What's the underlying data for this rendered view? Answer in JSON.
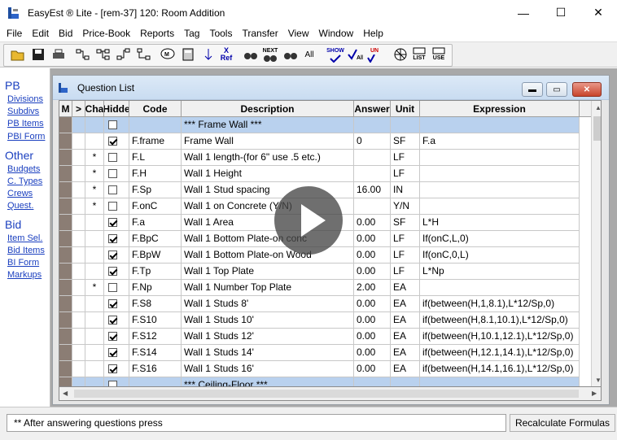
{
  "window": {
    "title": "EasyEst ® Lite - [rem-37] 120: Room Addition",
    "minimize": "—",
    "maximize": "☐",
    "close": "✕"
  },
  "menu": [
    "File",
    "Edit",
    "Bid",
    "Price-Book",
    "Reports",
    "Tag",
    "Tools",
    "Transfer",
    "View",
    "Window",
    "Help"
  ],
  "toolbar": {
    "x_ref": "X\nRef",
    "next": "NEXT",
    "all": "All",
    "show": "SHOW",
    "un": "UN",
    "list": "LIST",
    "use": "USE"
  },
  "side": {
    "pb_head": "PB",
    "pb_links": [
      "Divisions",
      "Subdivs",
      "PB Items",
      "PBI Form"
    ],
    "other_head": "Other",
    "other_links": [
      "Budgets",
      "C. Types",
      "Crews",
      "Quest."
    ],
    "bid_head": "Bid",
    "bid_links": [
      "Item Sel.",
      "Bid Items",
      "BI Form",
      "Markups"
    ]
  },
  "child": {
    "title": "Question List"
  },
  "grid": {
    "headers": [
      "M",
      ">",
      "Cha",
      "Hidde",
      "Code",
      "Description",
      "Answer",
      "Unit",
      "Expression"
    ],
    "rows": [
      {
        "section": true,
        "cha": "",
        "hidden": false,
        "code": "",
        "desc": "*** Frame Wall ***",
        "answer": "",
        "unit": "",
        "expr": ""
      },
      {
        "section": false,
        "cha": "",
        "hidden": true,
        "code": "F.frame",
        "desc": "Frame Wall",
        "answer": "0",
        "unit": "SF",
        "expr": "F.a"
      },
      {
        "section": false,
        "cha": "*",
        "hidden": false,
        "code": "F.L",
        "desc": "Wall 1 length-(for 6\" use .5 etc.)",
        "answer": "",
        "unit": "LF",
        "expr": ""
      },
      {
        "section": false,
        "cha": "*",
        "hidden": false,
        "code": "F.H",
        "desc": "Wall 1 Height",
        "answer": "",
        "unit": "LF",
        "expr": ""
      },
      {
        "section": false,
        "cha": "*",
        "hidden": false,
        "code": "F.Sp",
        "desc": "Wall 1 Stud spacing",
        "answer": "16.00",
        "unit": "IN",
        "expr": ""
      },
      {
        "section": false,
        "cha": "*",
        "hidden": false,
        "code": "F.onC",
        "desc": "Wall 1 on Concrete (Y/N)",
        "answer": "",
        "unit": "Y/N",
        "expr": ""
      },
      {
        "section": false,
        "cha": "",
        "hidden": true,
        "code": "F.a",
        "desc": "Wall 1 Area",
        "answer": "0.00",
        "unit": "SF",
        "expr": "L*H"
      },
      {
        "section": false,
        "cha": "",
        "hidden": true,
        "code": "F.BpC",
        "desc": "Wall 1 Bottom Plate-on conc",
        "answer": "0.00",
        "unit": "LF",
        "expr": "If(onC,L,0)"
      },
      {
        "section": false,
        "cha": "",
        "hidden": true,
        "code": "F.BpW",
        "desc": "Wall 1 Bottom Plate-on Wood",
        "answer": "0.00",
        "unit": "LF",
        "expr": "If(onC,0,L)"
      },
      {
        "section": false,
        "cha": "",
        "hidden": true,
        "code": "F.Tp",
        "desc": "Wall 1 Top Plate",
        "answer": "0.00",
        "unit": "LF",
        "expr": "L*Np"
      },
      {
        "section": false,
        "cha": "*",
        "hidden": false,
        "code": "F.Np",
        "desc": "Wall 1 Number Top Plate",
        "answer": "2.00",
        "unit": "EA",
        "expr": ""
      },
      {
        "section": false,
        "cha": "",
        "hidden": true,
        "code": "F.S8",
        "desc": "Wall 1 Studs 8'",
        "answer": "0.00",
        "unit": "EA",
        "expr": "if(between(H,1,8.1),L*12/Sp,0)"
      },
      {
        "section": false,
        "cha": "",
        "hidden": true,
        "code": "F.S10",
        "desc": "Wall 1 Studs 10'",
        "answer": "0.00",
        "unit": "EA",
        "expr": "if(between(H,8.1,10.1),L*12/Sp,0)"
      },
      {
        "section": false,
        "cha": "",
        "hidden": true,
        "code": "F.S12",
        "desc": "Wall 1 Studs 12'",
        "answer": "0.00",
        "unit": "EA",
        "expr": "if(between(H,10.1,12.1),L*12/Sp,0)"
      },
      {
        "section": false,
        "cha": "",
        "hidden": true,
        "code": "F.S14",
        "desc": "Wall 1 Studs 14'",
        "answer": "0.00",
        "unit": "EA",
        "expr": "if(between(H,12.1,14.1),L*12/Sp,0)"
      },
      {
        "section": false,
        "cha": "",
        "hidden": true,
        "code": "F.S16",
        "desc": "Wall 1 Studs 16'",
        "answer": "0.00",
        "unit": "EA",
        "expr": "if(between(H,14.1,16.1),L*12/Sp,0)"
      },
      {
        "section": true,
        "cha": "",
        "hidden": false,
        "code": "",
        "desc": "*** Ceiling-Floor ***",
        "answer": "",
        "unit": "",
        "expr": ""
      }
    ]
  },
  "status": {
    "message": "** After answering questions press",
    "recalc_label": "Recalculate Formulas"
  }
}
